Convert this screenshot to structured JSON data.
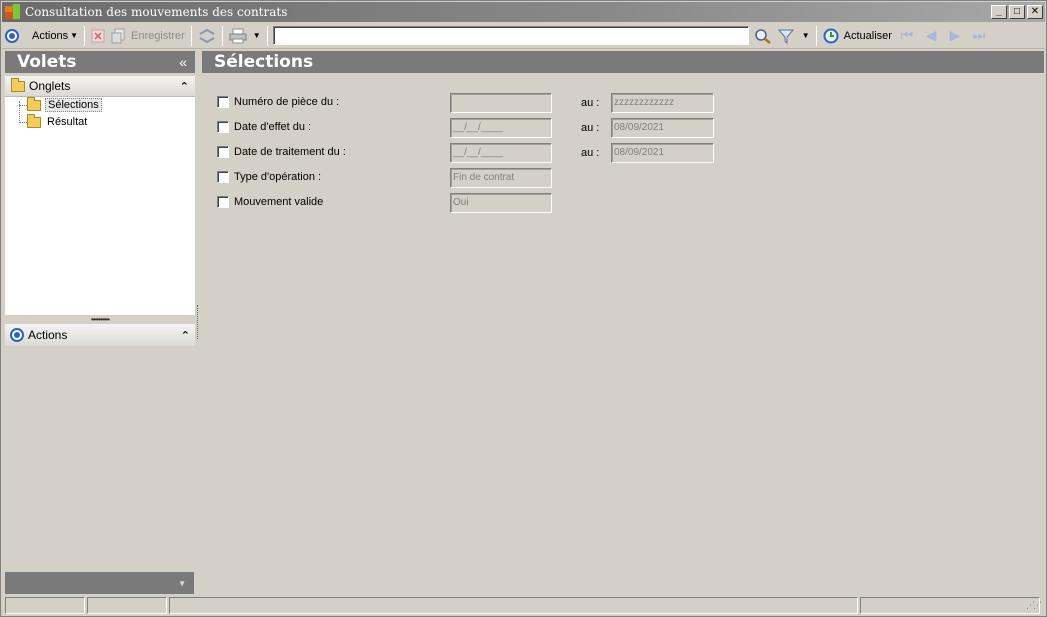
{
  "window": {
    "title": "Consultation des mouvements des contrats",
    "minimize": "_",
    "maximize": "□",
    "close": "✕"
  },
  "toolbar": {
    "actions_label": "Actions",
    "save_label": "Enregistrer",
    "search_value": "",
    "refresh_label": "Actualiser"
  },
  "left": {
    "title": "Volets",
    "collapse_glyph": "«",
    "onglets_label": "Onglets",
    "tree": [
      "Sélections",
      "Résultat"
    ],
    "actions_label": "Actions",
    "expand_glyph": "»"
  },
  "main": {
    "title": "Sélections",
    "rows": [
      {
        "label": "Numéro de pièce du :",
        "from": "",
        "to_label": "au :",
        "to": "zzzzzzzzzzzz"
      },
      {
        "label": "Date d'effet du :",
        "from": "__/__/____",
        "to_label": "au :",
        "to": "08/09/2021"
      },
      {
        "label": "Date de traitement du :",
        "from": "__/__/____",
        "to_label": "au :",
        "to": "08/09/2021"
      },
      {
        "label": "Type d'opération :",
        "from": "Fin de contrat"
      },
      {
        "label": "Mouvement valide",
        "from": "Oui"
      }
    ]
  },
  "colors": {
    "header_gray": "#7a7a7a",
    "face": "#d4d0c8",
    "accent_blue": "#2a62c4"
  }
}
